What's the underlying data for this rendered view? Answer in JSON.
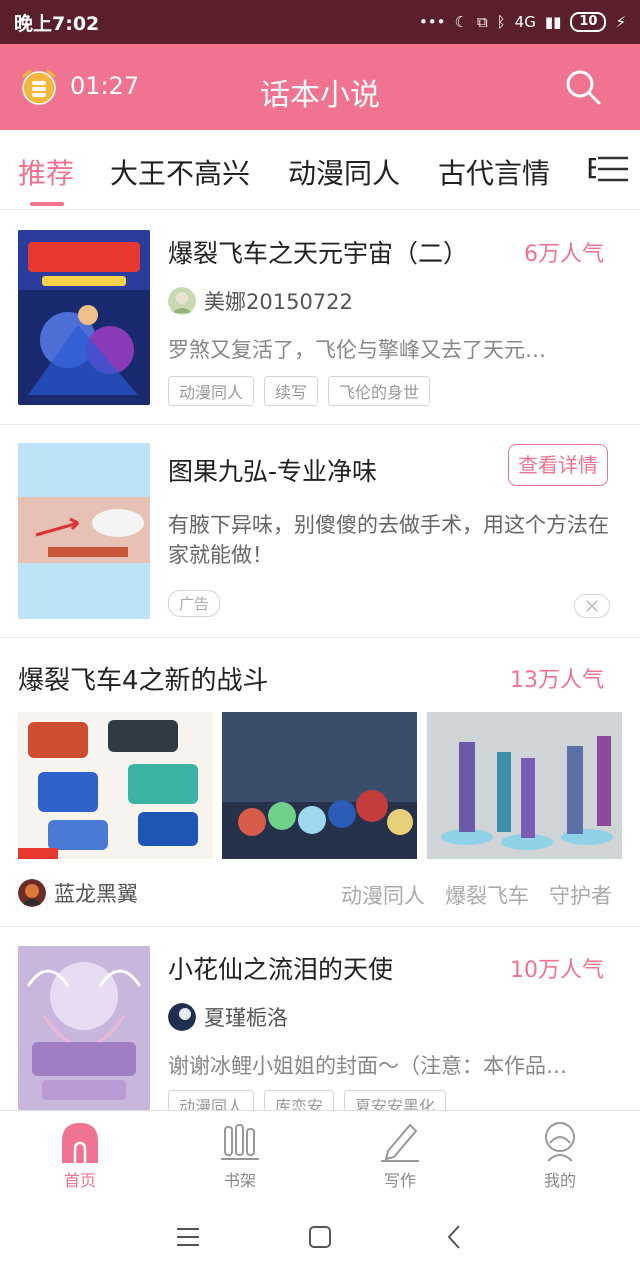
{
  "status_bar": {
    "time": "晚上7:02",
    "network": "4G",
    "battery": "10"
  },
  "app_bar": {
    "timer": "01:27",
    "title": "话本小说"
  },
  "tabs": [
    {
      "label": "推荐"
    },
    {
      "label": "大王不高兴"
    },
    {
      "label": "动漫同人"
    },
    {
      "label": "古代言情"
    },
    {
      "label": "E"
    }
  ],
  "feed": {
    "book1": {
      "title": "爆裂飞车之天元宇宙（二）",
      "popularity": "6万人气",
      "author": "美娜20150722",
      "description": "罗煞又复活了，飞伦与擎峰又去了天元…",
      "tags": [
        "动漫同人",
        "续写",
        "飞伦的身世"
      ]
    },
    "ad": {
      "title": "图果九弘-专业净味",
      "button": "查看详情",
      "description": "有腋下异味，别傻傻的去做手术，用这个方法在家就能做！",
      "tag": "广告"
    },
    "collection": {
      "title": "爆裂飞车4之新的战斗",
      "popularity": "13万人气",
      "author": "蓝龙黑翼",
      "tags": [
        "动漫同人",
        "爆裂飞车",
        "守护者"
      ]
    },
    "book2": {
      "title": "小花仙之流泪的天使",
      "popularity": "10万人气",
      "author": "夏瑾栀洛",
      "description": "谢谢冰鲤小姐姐的封面～（注意：本作品…",
      "tags": [
        "动漫同人",
        "库恋安",
        "夏安安黑化"
      ]
    }
  },
  "bottom_nav": [
    {
      "label": "首页"
    },
    {
      "label": "书架"
    },
    {
      "label": "写作"
    },
    {
      "label": "我的"
    }
  ],
  "colors": {
    "accent": "#f0738f",
    "status_bar": "#5a1f2a"
  }
}
